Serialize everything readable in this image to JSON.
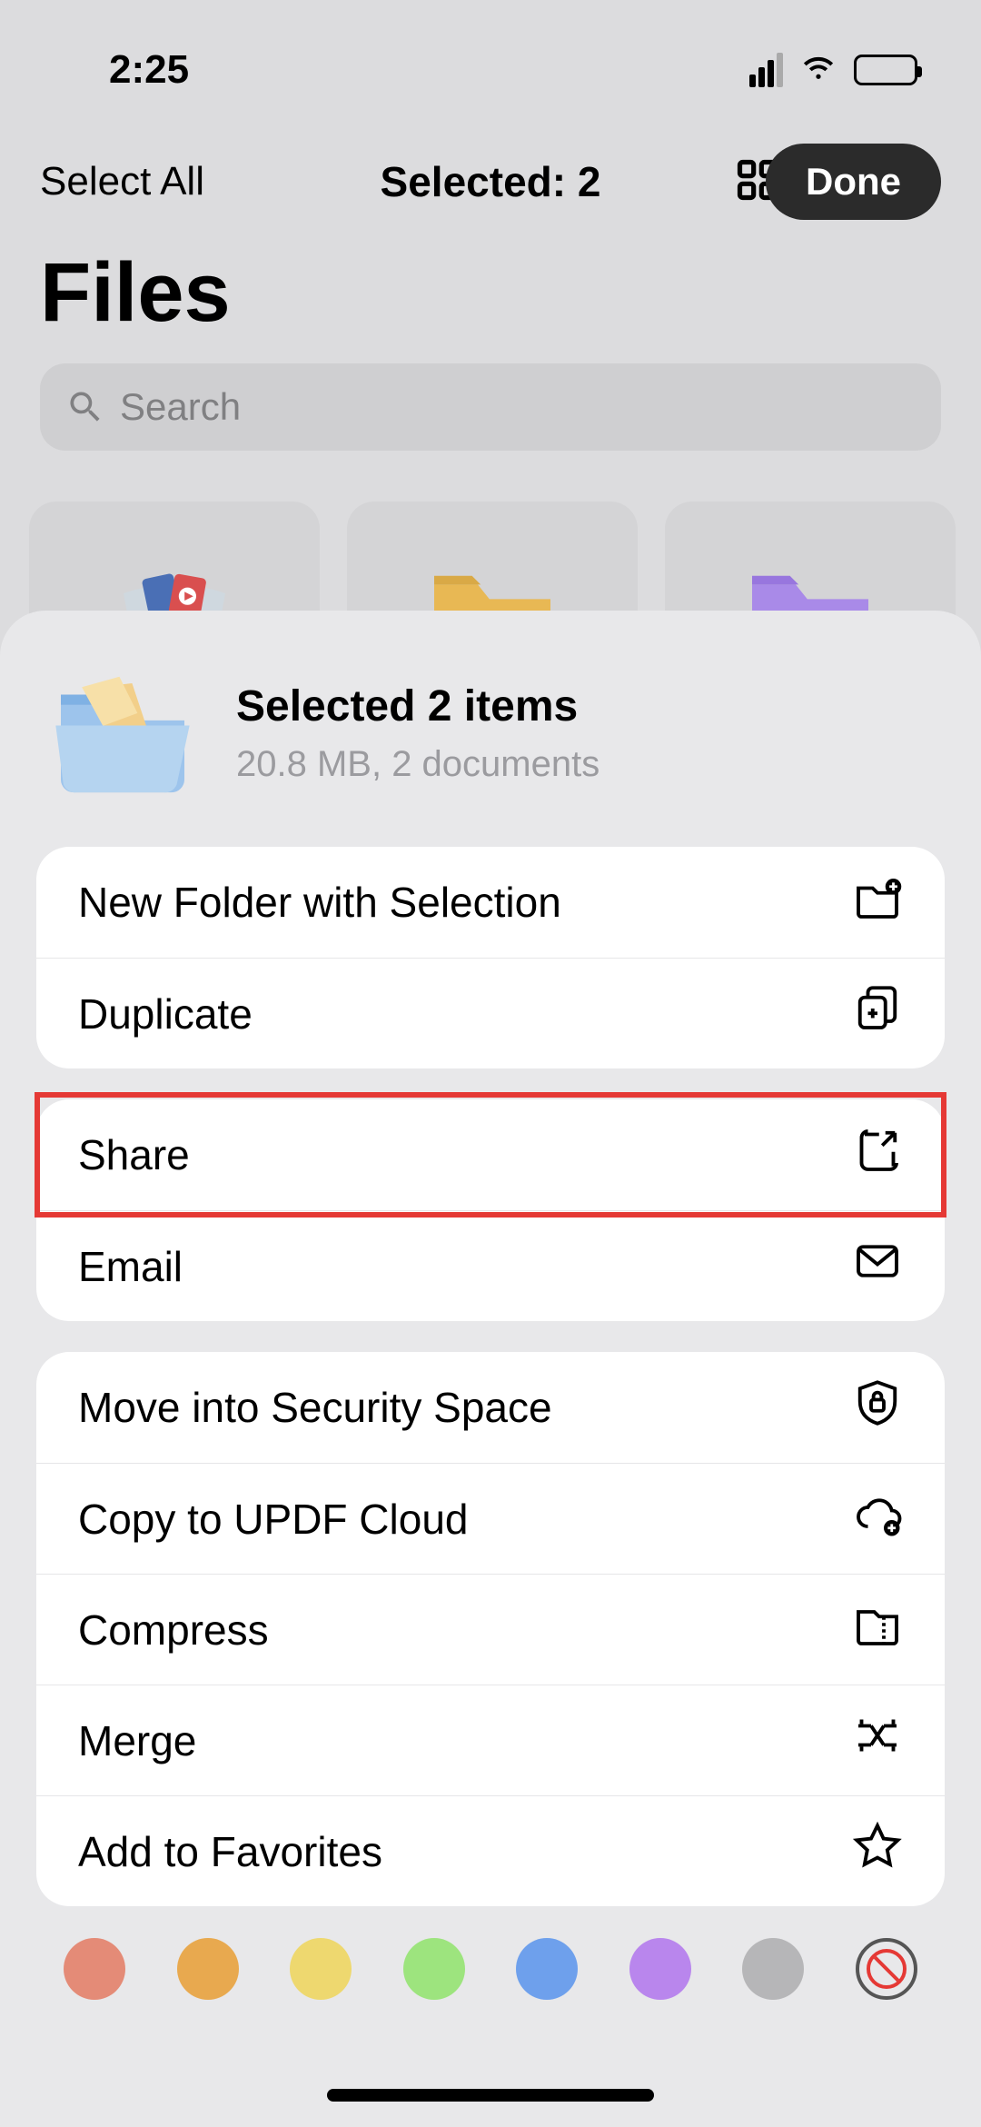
{
  "status": {
    "time": "2:25"
  },
  "nav": {
    "select_all": "Select All",
    "selected": "Selected: 2",
    "done": "Done"
  },
  "page": {
    "title": "Files"
  },
  "search": {
    "placeholder": "Search"
  },
  "sheet": {
    "title": "Selected 2 items",
    "subtitle": "20.8 MB, 2 documents"
  },
  "actions": {
    "group1": [
      {
        "label": "New Folder with Selection",
        "icon": "folder-plus"
      },
      {
        "label": "Duplicate",
        "icon": "copy-plus"
      }
    ],
    "group2": [
      {
        "label": "Share",
        "icon": "share",
        "highlight": true
      },
      {
        "label": "Email",
        "icon": "envelope"
      }
    ],
    "group3": [
      {
        "label": "Move into Security Space",
        "icon": "shield-lock"
      },
      {
        "label": "Copy to UPDF Cloud",
        "icon": "cloud-plus"
      },
      {
        "label": "Compress",
        "icon": "archive"
      },
      {
        "label": "Merge",
        "icon": "merge"
      },
      {
        "label": "Add to Favorites",
        "icon": "star"
      }
    ]
  },
  "colors": [
    "#e48b77",
    "#e8a94f",
    "#eed86f",
    "#9de47e",
    "#6ea0ec",
    "#b986ed",
    "#b6b6b8"
  ]
}
